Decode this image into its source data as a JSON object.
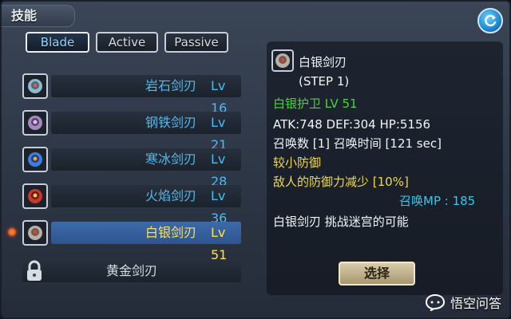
{
  "window": {
    "title": "技能"
  },
  "tabs": [
    {
      "label": "Blade",
      "active": true
    },
    {
      "label": "Active",
      "active": false
    },
    {
      "label": "Passive",
      "active": false
    }
  ],
  "skills": [
    {
      "name": "岩石剑刃",
      "level": "Lv 16",
      "icon": "rock-blade-icon",
      "selected": false
    },
    {
      "name": "钢铁剑刃",
      "level": "Lv 21",
      "icon": "steel-blade-icon",
      "selected": false
    },
    {
      "name": "寒冰剑刃",
      "level": "Lv 28",
      "icon": "ice-blade-icon",
      "selected": false
    },
    {
      "name": "火焰剑刃",
      "level": "Lv 36",
      "icon": "flame-blade-icon",
      "selected": false
    },
    {
      "name": "白银剑刃",
      "level": "Lv 51",
      "icon": "silver-blade-icon",
      "selected": true
    }
  ],
  "locked_skill": {
    "name": "黄金剑刃",
    "icon": "lock-icon"
  },
  "detail": {
    "name": "白银剑刃",
    "step": "(STEP 1)",
    "guard": "白银护卫 LV 51",
    "stats": "ATK:748 DEF:304 HP:5156",
    "summon": "召唤数 [1] 召唤时间 [121 sec]",
    "defense_note": "较小防御",
    "effect": "敌人的防御力减少 [10%]",
    "summon_mp": "召唤MP : 185",
    "description": "白银剑刃 挑战迷宫的可能",
    "choose_label": "选择"
  },
  "watermark": {
    "text": "悟空问答"
  },
  "colors": {
    "skill_name": "#4fb9f0",
    "selected_name": "#ffe14a",
    "guard": "#4fd23e",
    "effect": "#f1d84a",
    "mp": "#39c6e8"
  }
}
